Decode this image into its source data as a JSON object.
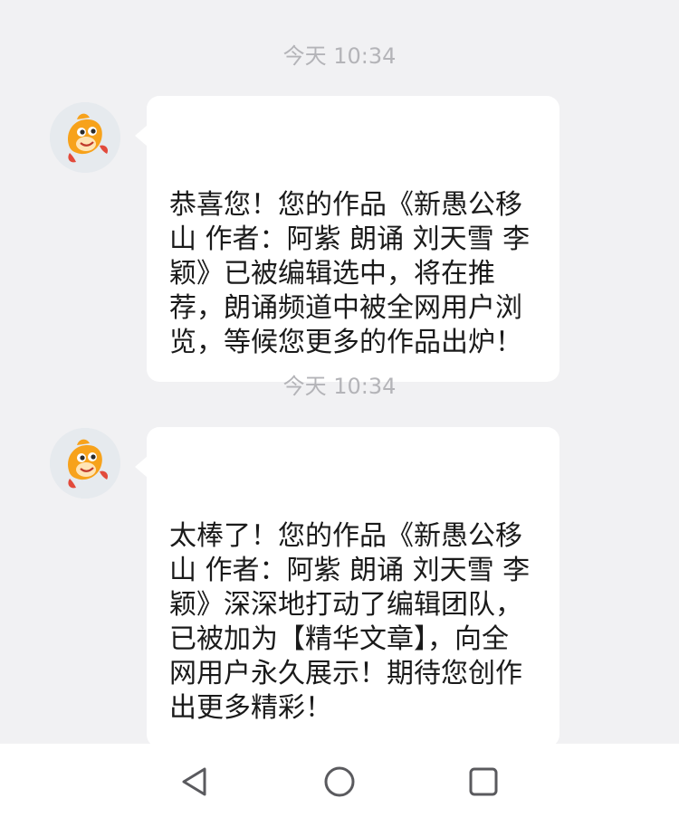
{
  "messages": [
    {
      "timestamp": "今天 10:34",
      "text": "恭喜您！您的作品《新愚公移\n山 作者：阿紫 朗诵 刘天雪 李\n颖》已被编辑选中，将在推\n荐，朗诵频道中被全网用户浏\n览，等候您更多的作品出炉！"
    },
    {
      "timestamp": "今天 10:34",
      "text": "太棒了！您的作品《新愚公移\n山 作者：阿紫 朗诵 刘天雪 李\n颖》深深地打动了编辑团队，\n已被加为【精华文章】，向全\n网用户永久展示！期待您创作\n出更多精彩！"
    }
  ],
  "avatar_icon": "orange-fish-mascot-icon",
  "navbar": {
    "back_icon": "triangle-back-icon",
    "home_icon": "circle-home-icon",
    "recents_icon": "square-recents-icon"
  },
  "colors": {
    "background": "#f1f1f3",
    "bubble": "#ffffff",
    "timestamp": "#b4b4b8",
    "mascot": "#f7a21b"
  }
}
